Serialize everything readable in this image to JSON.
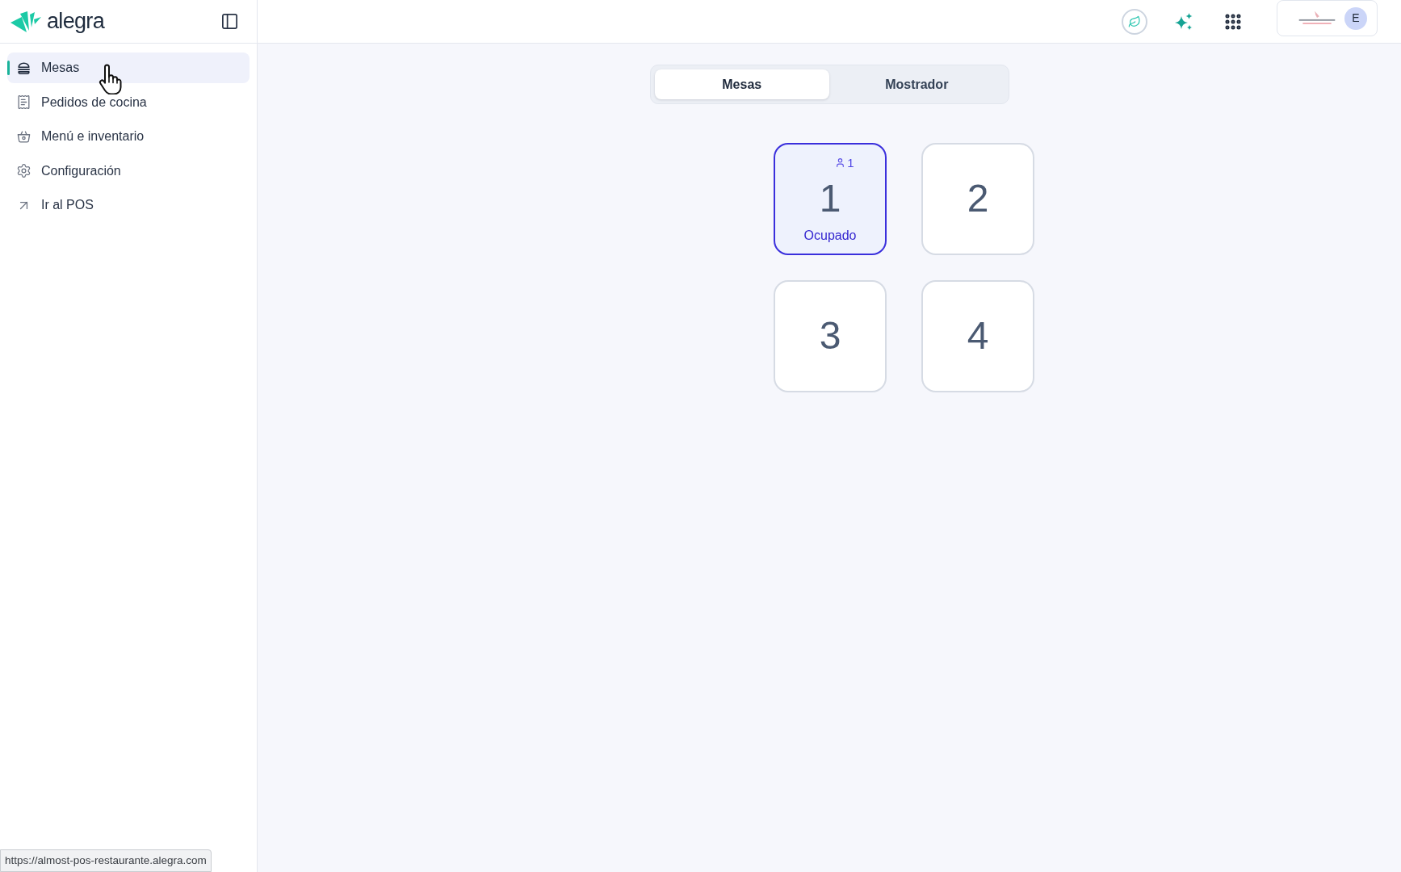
{
  "sidebar": {
    "logo": {
      "wordmark": "alegra"
    },
    "items": [
      {
        "label": "Mesas",
        "selected": true
      },
      {
        "label": "Pedidos de cocina",
        "selected": false
      },
      {
        "label": "Menú e inventario",
        "selected": false
      },
      {
        "label": "Configuración",
        "selected": false
      },
      {
        "label": "Ir al POS",
        "selected": false
      }
    ]
  },
  "header": {
    "account": {
      "avatar_initial": "E"
    }
  },
  "tabs": [
    {
      "label": "Mesas",
      "selected": true
    },
    {
      "label": "Mostrador",
      "selected": false
    }
  ],
  "tables": [
    {
      "number": "1",
      "occupied": true,
      "guests": "1",
      "status": "Ocupado"
    },
    {
      "number": "2",
      "occupied": false
    },
    {
      "number": "3",
      "occupied": false
    },
    {
      "number": "4",
      "occupied": false
    }
  ],
  "status_url": "https://almost-pos-restaurante.alegra.com"
}
